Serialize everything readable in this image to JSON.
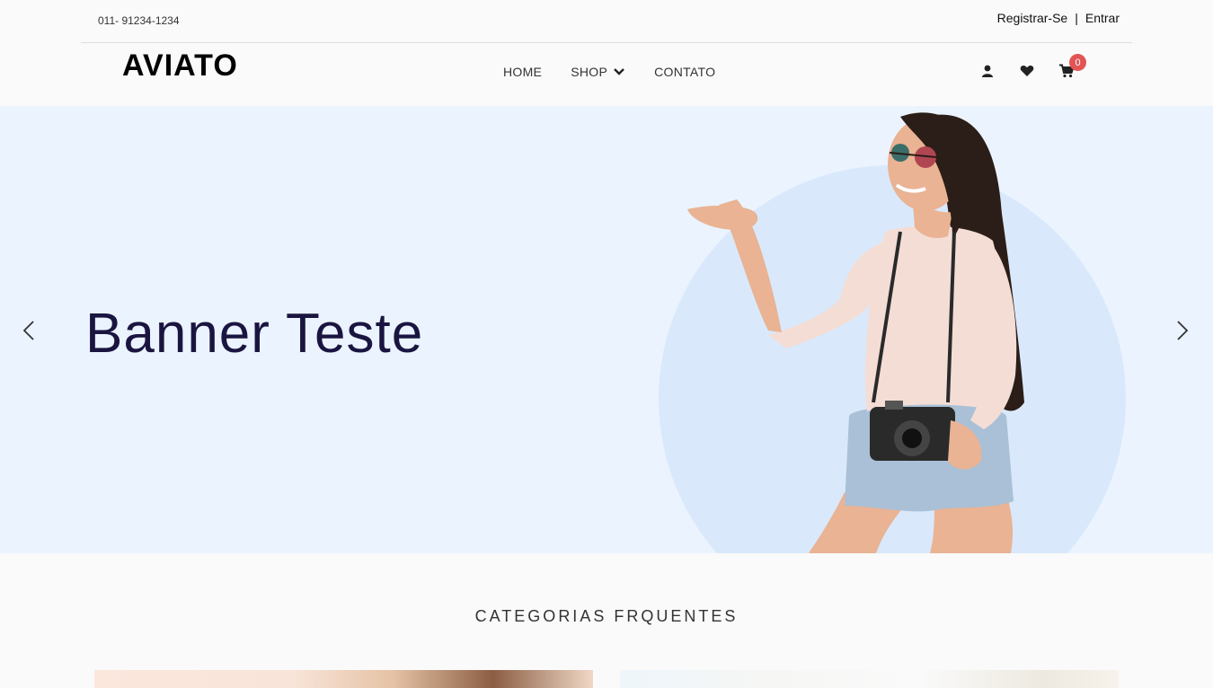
{
  "topbar": {
    "phone": "011- 91234-1234",
    "register": "Registrar-Se",
    "separator": "|",
    "login": "Entrar"
  },
  "header": {
    "logo": "AVIATO",
    "nav": [
      {
        "label": "HOME"
      },
      {
        "label": "SHOP",
        "icon": "chevron-down-icon"
      },
      {
        "label": "CONTATO"
      }
    ],
    "icons": [
      "user-icon",
      "heart-icon",
      "cart-icon"
    ],
    "cart_count": "0",
    "badge_color": "#e25555"
  },
  "hero": {
    "title": "Banner Teste",
    "background": "#ebf3fe",
    "prev_icon": "chevron-left-icon",
    "next_icon": "chevron-right-icon"
  },
  "categories": {
    "title": "CATEGORIAS FRQUENTES"
  }
}
